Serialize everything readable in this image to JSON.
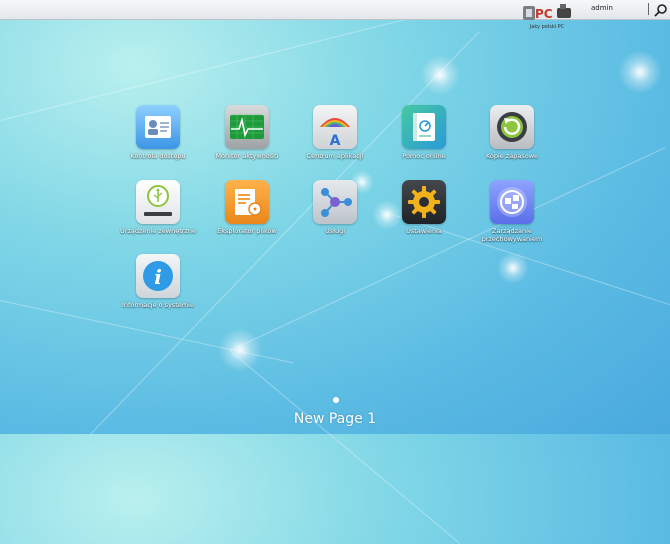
{
  "topbar": {
    "logo_text": "Jaky polski PC",
    "user": "admin"
  },
  "apps": [
    {
      "label": "Kontrola dostępu",
      "icon": "access-control-icon"
    },
    {
      "label": "Monitor aktywności",
      "icon": "activity-monitor-icon"
    },
    {
      "label": "Centrum aplikacji",
      "icon": "app-central-icon"
    },
    {
      "label": "Pomoc online",
      "icon": "online-help-icon"
    },
    {
      "label": "Kopie zapasowe",
      "icon": "backup-icon"
    },
    {
      "label": "Urządzenie zewnętrzne",
      "icon": "usb-device-icon"
    },
    {
      "label": "Eksplorator plików",
      "icon": "file-explorer-icon"
    },
    {
      "label": "Usługi",
      "icon": "services-icon"
    },
    {
      "label": "Ustawienia",
      "icon": "settings-gear-icon"
    },
    {
      "label": "Zarządzanie przechowywaniem",
      "icon": "storage-manager-icon"
    },
    {
      "label": "Informacje o systemie",
      "icon": "system-info-icon"
    }
  ],
  "pager": {
    "page_name": "New Page 1"
  }
}
